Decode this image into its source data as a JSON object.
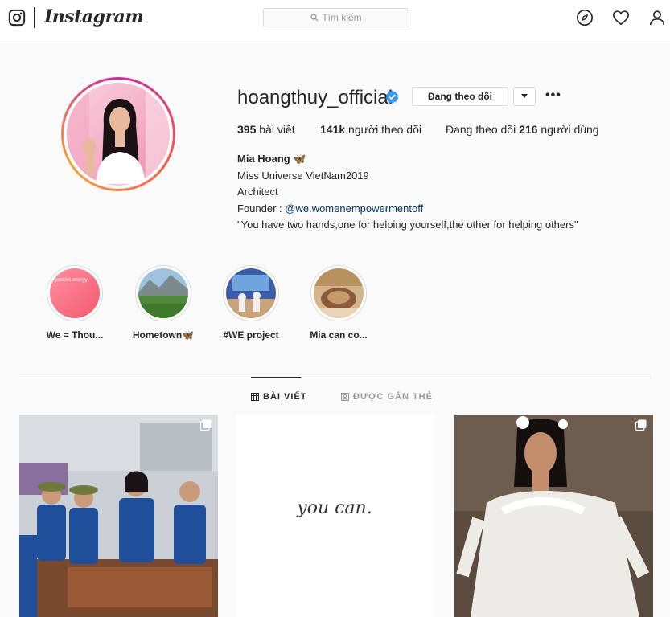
{
  "nav": {
    "brand": "Instagram",
    "search_placeholder": "Tìm kiếm"
  },
  "profile": {
    "username": "hoangthuy_official",
    "follow_label": "Đang theo dõi",
    "more_label": "•••",
    "stats": {
      "posts_count": "395",
      "posts_label": " bài viết",
      "followers_count": "141k",
      "followers_label": " người theo dõi",
      "following_prefix": "Đang theo dõi ",
      "following_count": "216",
      "following_label": " người dùng"
    },
    "bio": {
      "name": "Mia Hoang 🦋",
      "line1": "Miss Universe VietNam2019",
      "line2": "Architect",
      "founder_prefix": "Founder : ",
      "founder_link": "@we.womenempowermentoff",
      "quote": "\"You have two hands,one for helping yourself,the other for helping others\""
    }
  },
  "highlights": [
    {
      "label": "We = Thou...",
      "thumb_text": "positive energy"
    },
    {
      "label": "Hometown🦋"
    },
    {
      "label": "#WE project"
    },
    {
      "label": "Mia can co..."
    }
  ],
  "tabs": {
    "posts": "BÀI VIẾT",
    "tagged": "ĐƯỢC GẮN THẺ"
  },
  "posts": [
    {
      "caption": ""
    },
    {
      "caption": "you can."
    },
    {
      "caption": ""
    }
  ],
  "colors": {
    "border": "#dbdbdb",
    "verified": "#3897f0",
    "link": "#003569",
    "text": "#262626"
  }
}
